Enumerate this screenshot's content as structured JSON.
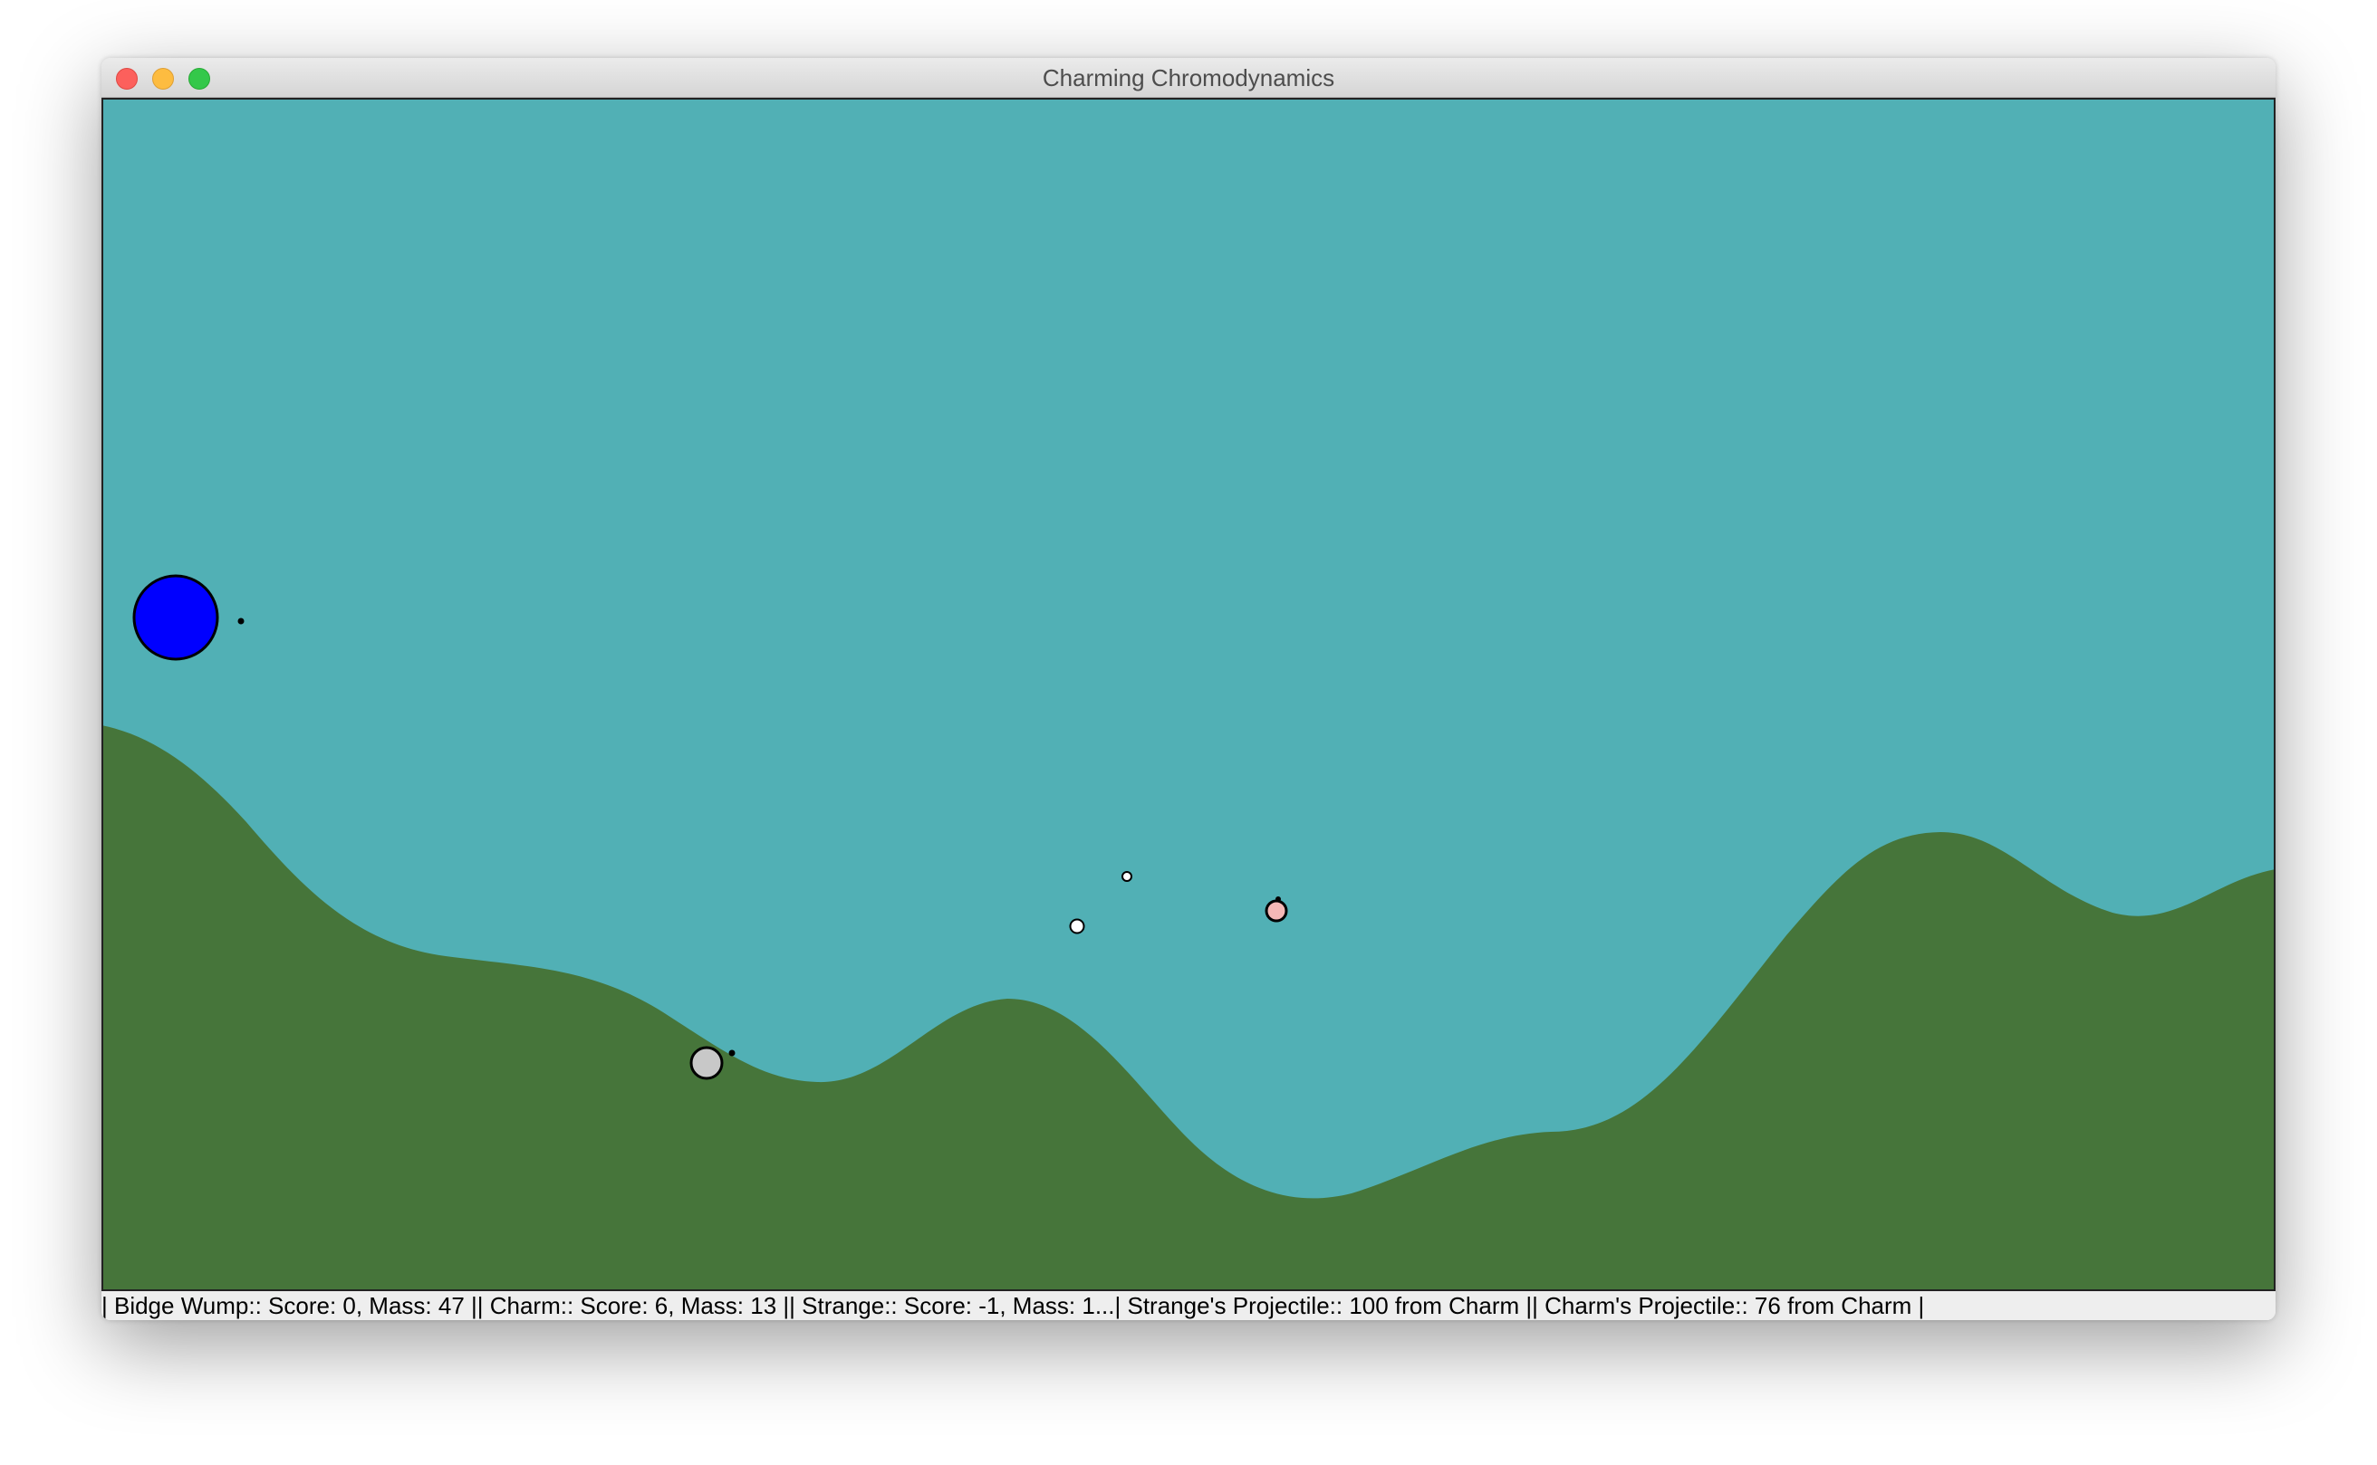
{
  "window": {
    "title": "Charming Chromodynamics"
  },
  "scene": {
    "sky_color": "#51b0b5",
    "ground_color": "#46753a",
    "bodies": [
      {
        "name": "bidge-wump-ball",
        "color": "#0000ff"
      },
      {
        "name": "charm-ball",
        "color": "#c8c8c8"
      },
      {
        "name": "strange-ball",
        "color": "#f4b8b6"
      },
      {
        "name": "strange-projectile",
        "color": "#ffffff"
      },
      {
        "name": "charm-projectile",
        "color": "#ffffff"
      }
    ]
  },
  "status": {
    "text": "| Bidge Wump:: Score: 0, Mass: 47 || Charm:: Score: 6, Mass: 13 || Strange:: Score: -1, Mass: 1...| Strange's Projectile:: 100 from Charm || Charm's Projectile:: 76 from Charm |"
  }
}
